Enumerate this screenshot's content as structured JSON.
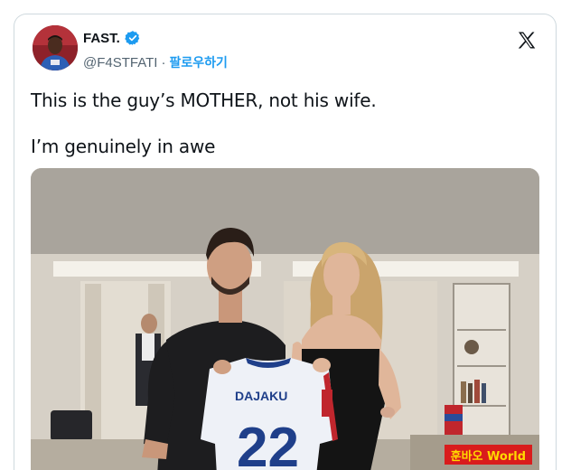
{
  "tweet": {
    "display_name": "FAST.",
    "handle": "@F4STFATI",
    "separator": "·",
    "follow_label": "팔로우하기",
    "text_line1": "This is the guy’s MOTHER, not his wife.",
    "text_line2": "I’m genuinely in awe"
  },
  "photo": {
    "jersey_name": "DAJAKU",
    "jersey_number": "22",
    "watermark": "훈바오 World"
  },
  "colors": {
    "verified_badge": "#1d9bf0",
    "follow_link": "#1d9bf0",
    "handle_gray": "#536471",
    "watermark_bg": "#d91c1c",
    "watermark_text": "#ffd800"
  },
  "icons": {
    "verified": "verified-badge-icon",
    "platform": "x-logo-icon"
  }
}
